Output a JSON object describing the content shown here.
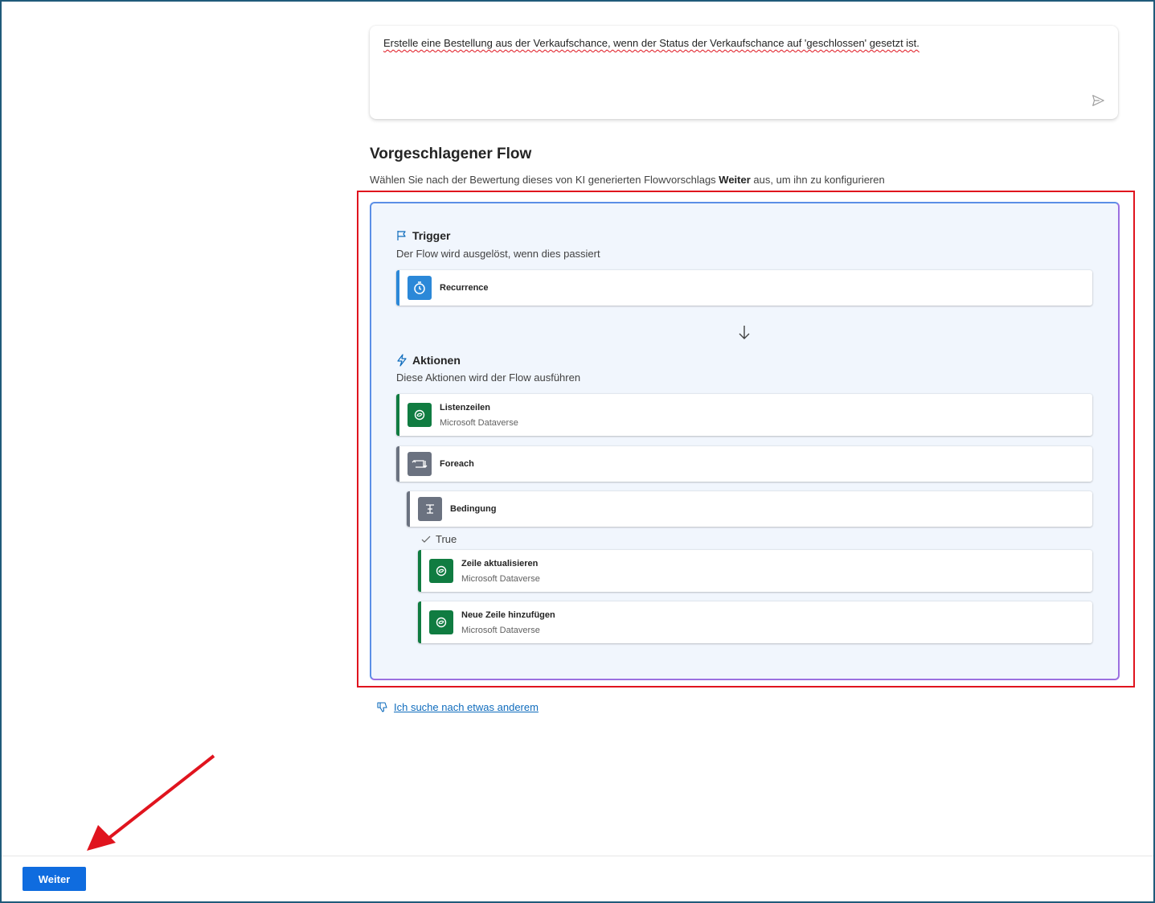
{
  "prompt": {
    "text": "Erstelle eine Bestellung aus der Verkaufschance, wenn der Status der Verkaufschance auf 'geschlossen' gesetzt ist."
  },
  "suggested_flow": {
    "title": "Vorgeschlagener Flow",
    "desc_before": "Wählen Sie nach der Bewertung dieses von KI generierten Flowvorschlags ",
    "desc_bold": "Weiter",
    "desc_after": " aus, um ihn zu konfigurieren"
  },
  "trigger": {
    "heading": "Trigger",
    "subtitle": "Der Flow wird ausgelöst, wenn dies passiert",
    "steps": [
      {
        "title": "Recurrence"
      }
    ]
  },
  "actions": {
    "heading": "Aktionen",
    "subtitle": "Diese Aktionen wird der Flow ausführen",
    "steps": [
      {
        "title": "Listenzeilen",
        "subtitle": "Microsoft Dataverse"
      },
      {
        "title": "Foreach"
      },
      {
        "title": "Bedingung"
      },
      {
        "title": "Zeile aktualisieren",
        "subtitle": "Microsoft Dataverse"
      },
      {
        "title": "Neue Zeile hinzufügen",
        "subtitle": "Microsoft Dataverse"
      }
    ],
    "true_label": "True"
  },
  "alt_link": "Ich suche nach etwas anderem",
  "footer": {
    "next_button": "Weiter"
  },
  "colors": {
    "accent": "#0f6cdf",
    "dataverse": "#107c41",
    "annotation": "#e0141e"
  }
}
